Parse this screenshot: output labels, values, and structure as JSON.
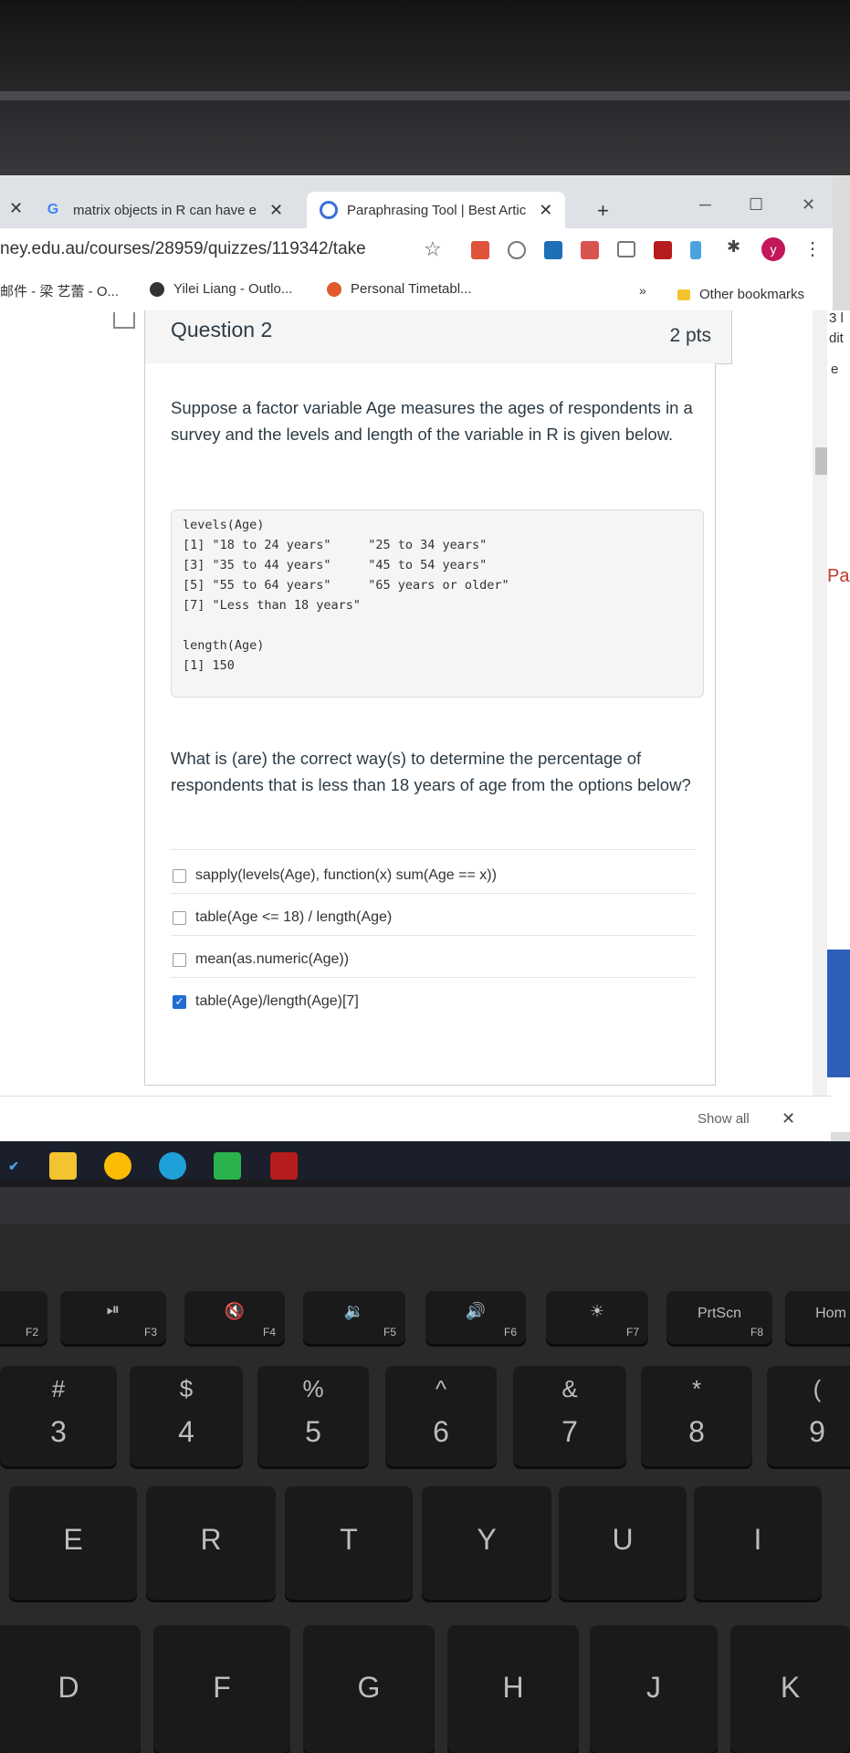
{
  "browser": {
    "tabs": [
      {
        "title": "matrix objects in R can have e"
      },
      {
        "title": "Paraphrasing Tool | Best Artic"
      }
    ],
    "url": "ney.edu.au/courses/28959/quizzes/119342/take",
    "avatar_letter": "y",
    "bookmarks": [
      {
        "label": "邮件 - 梁 艺蕾 - O..."
      },
      {
        "label": "Yilei Liang - Outlo..."
      },
      {
        "label": "Personal Timetabl..."
      }
    ],
    "bookmarks_overflow": "»",
    "other_bookmarks": "Other bookmarks"
  },
  "question": {
    "title": "Question 2",
    "points": "2 pts",
    "prompt": "Suppose a factor variable Age measures the ages of respondents in a survey and the levels and length of the variable in R is given below.",
    "code": [
      "levels(Age)",
      "[1] \"18 to 24 years\"     \"25 to 34 years\"",
      "[3] \"35 to 44 years\"     \"45 to 54 years\"",
      "[5] \"55 to 64 years\"     \"65 years or older\"",
      "[7] \"Less than 18 years\"",
      "",
      "length(Age)",
      "[1] 150"
    ],
    "ask": "What is (are) the correct way(s) to determine the percentage of respondents that is less than 18 years of age from the options below?",
    "options": [
      {
        "label": "sapply(levels(Age), function(x) sum(Age == x))",
        "checked": false
      },
      {
        "label": "table(Age <= 18) / length(Age)",
        "checked": false
      },
      {
        "label": "mean(as.numeric(Age))",
        "checked": false
      },
      {
        "label": "table(Age)/length(Age)[7]",
        "checked": true
      }
    ]
  },
  "right_panel": {
    "snippets": [
      "3 l",
      "dit",
      "e",
      "Pa"
    ]
  },
  "download_bar": {
    "show_all": "Show all"
  },
  "keyboard": {
    "fn_row": [
      {
        "label": "F2",
        "icon": ""
      },
      {
        "label": "F3",
        "icon": "⏯"
      },
      {
        "label": "F4",
        "icon": "🔇"
      },
      {
        "label": "F5",
        "icon": "🔉"
      },
      {
        "label": "F6",
        "icon": "🔊"
      },
      {
        "label": "F7",
        "icon": "☀"
      },
      {
        "label": "F8",
        "icon": "PrtScn"
      },
      {
        "label": "",
        "icon": "Hom"
      }
    ],
    "num_row": [
      {
        "top": "#",
        "bottom": "3"
      },
      {
        "top": "$",
        "bottom": "4"
      },
      {
        "top": "%",
        "bottom": "5"
      },
      {
        "top": "^",
        "bottom": "6"
      },
      {
        "top": "&",
        "bottom": "7"
      },
      {
        "top": "*",
        "bottom": "8"
      },
      {
        "top": "(",
        "bottom": "9"
      }
    ],
    "row_qwerty": [
      "E",
      "R",
      "T",
      "Y",
      "U",
      "I"
    ],
    "row_asdf": [
      "D",
      "F",
      "G",
      "H",
      "J",
      "K"
    ]
  }
}
